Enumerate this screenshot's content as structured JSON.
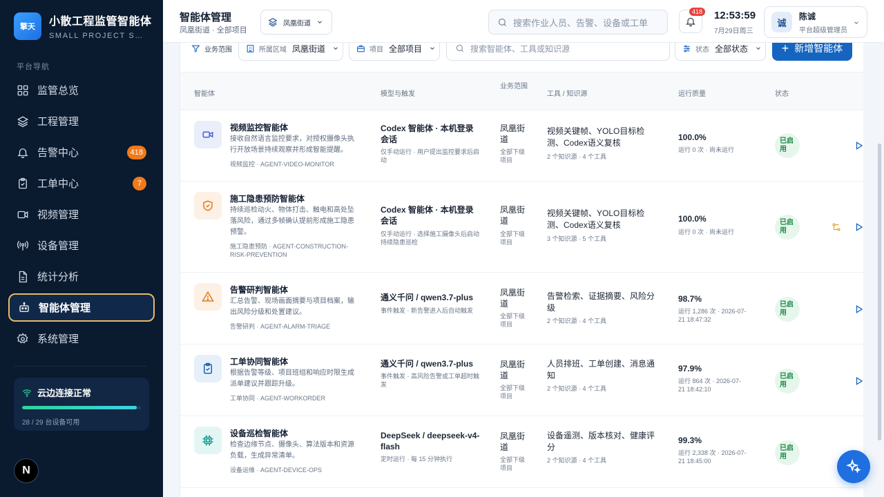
{
  "brand": {
    "logo": "擎天",
    "name": "小散工程监管智能体",
    "subtitle": "SMALL PROJECT SAFETY"
  },
  "sidebar": {
    "section_title": "平台导航",
    "items": [
      {
        "label": "监管总览",
        "icon": "dashboard-icon"
      },
      {
        "label": "工程管理",
        "icon": "layers-icon"
      },
      {
        "label": "告警中心",
        "icon": "bell-icon",
        "badge": "418"
      },
      {
        "label": "工单中心",
        "icon": "clipboard-icon",
        "badge": "7"
      },
      {
        "label": "视频管理",
        "icon": "video-icon"
      },
      {
        "label": "设备管理",
        "icon": "antenna-icon"
      },
      {
        "label": "统计分析",
        "icon": "document-icon"
      },
      {
        "label": "智能体管理",
        "icon": "robot-icon",
        "active": true
      },
      {
        "label": "系统管理",
        "icon": "gear-icon"
      }
    ],
    "cloud": {
      "title": "云边连接正常",
      "detail": "28 / 29 台设备可用",
      "online": 28,
      "total": 29
    },
    "user_initial": "N"
  },
  "header": {
    "title": "智能体管理",
    "subtitle": "凤凰街道 · 全部项目",
    "area": "凤凰街道",
    "search_placeholder": "搜索作业人员、告警、设备或工单",
    "alert_count": "418",
    "time": "12:53:59",
    "date": "7月29日周三",
    "user": {
      "avatar": "诚",
      "name": "陈诚",
      "role": "平台超级管理员"
    }
  },
  "filters": {
    "label": "业务范围",
    "region_label": "所属区域",
    "region_value": "凤凰街道",
    "project_label": "项目",
    "project_value": "全部项目",
    "search_placeholder": "搜索智能体、工具或知识源",
    "status_label": "状态",
    "status_value": "全部状态",
    "add_button": "新增智能体"
  },
  "table": {
    "headers": {
      "agent": "智能体",
      "model": "模型与触发",
      "scope": "业务范围",
      "tools": "工具 / 知识源",
      "quality": "运行质量",
      "status": "状态"
    },
    "rows": [
      {
        "name": "视频监控智能体",
        "icon": "camera-icon",
        "desc": "接收自然语言监控要求，对授权摄像头执行开放场景持续观察并形成智能提醒。",
        "tag": "视频监控 · AGENT-VIDEO-MONITOR",
        "model": "Codex 智能体 · 本机登录会话",
        "trigger": "仅手动运行 · 用户提出监控要求后启动",
        "scope": "凤凰街道",
        "scope_sub": "全部下级项目",
        "tools": "视频关键帧、YOLO目标检测、Codex语义复核",
        "tools_sub": "2 个知识源 · 4 个工具",
        "quality": "100.0%",
        "quality_sub": "运行 0 次 · 尚未运行",
        "status": "已启用"
      },
      {
        "name": "施工隐患预防智能体",
        "icon": "shield-icon",
        "desc": "持续巡检动火、物体打击、触电和高处坠落风险，通过多帧确认提前形成施工隐患预警。",
        "tag": "施工隐患预防 · AGENT-CONSTRUCTION-RISK-PREVENTION",
        "model": "Codex 智能体 · 本机登录会话",
        "trigger": "仅手动运行 · 选择施工摄像头后启动持续隐患巡检",
        "scope": "凤凰街道",
        "scope_sub": "全部下级项目",
        "tools": "视频关键帧、YOLO目标检测、Codex语义复核",
        "tools_sub": "3 个知识源 · 5 个工具",
        "quality": "100.0%",
        "quality_sub": "运行 0 次 · 尚未运行",
        "status": "已启用"
      },
      {
        "name": "告警研判智能体",
        "icon": "warning-icon",
        "desc": "汇总告警、现场画面摘要与项目档案，输出风险分级和处置建议。",
        "tag": "告警研判 · AGENT-ALARM-TRIAGE",
        "model": "通义千问 / qwen3.7-plus",
        "trigger": "事件触发 · 新告警进入后自动触发",
        "scope": "凤凰街道",
        "scope_sub": "全部下级项目",
        "tools": "告警检索、证据摘要、风险分级",
        "tools_sub": "2 个知识源 · 4 个工具",
        "quality": "98.7%",
        "quality_sub": "运行 1,286 次 · 2026-07-21 18:47:32",
        "status": "已启用"
      },
      {
        "name": "工单协同智能体",
        "icon": "clipboard-check-icon",
        "desc": "根据告警等级、项目班组和响应时限生成派单建议并跟踪升级。",
        "tag": "工单协同 · AGENT-WORKORDER",
        "model": "通义千问 / qwen3.7-plus",
        "trigger": "事件触发 · 高风险告警或工单超时触发",
        "scope": "凤凰街道",
        "scope_sub": "全部下级项目",
        "tools": "人员排班、工单创建、消息通知",
        "tools_sub": "2 个知识源 · 4 个工具",
        "quality": "97.9%",
        "quality_sub": "运行 864 次 · 2026-07-21 18:42:10",
        "status": "已启用"
      },
      {
        "name": "设备巡检智能体",
        "icon": "chip-icon",
        "desc": "检查边缘节点、摄像头、算法版本和资源负载，生成异常清单。",
        "tag": "设备运维 · AGENT-DEVICE-OPS",
        "model": "DeepSeek / deepseek-v4-flash",
        "trigger": "定时运行 · 每 15 分钟执行",
        "scope": "凤凰街道",
        "scope_sub": "全部下级项目",
        "tools": "设备遥测、版本核对、健康评分",
        "tools_sub": "2 个知识源 · 4 个工具",
        "quality": "99.3%",
        "quality_sub": "运行 2,338 次 · 2026-07-21 18:45:00",
        "status": "已启用"
      }
    ]
  },
  "colors": {
    "sidebar_bg": "#0a1a2f",
    "accent": "#1565c0",
    "active_border": "#e8b96a",
    "badge": "#f07a1a",
    "status_green": "#1b8a47"
  },
  "fab_icon": "sparkle-icon"
}
